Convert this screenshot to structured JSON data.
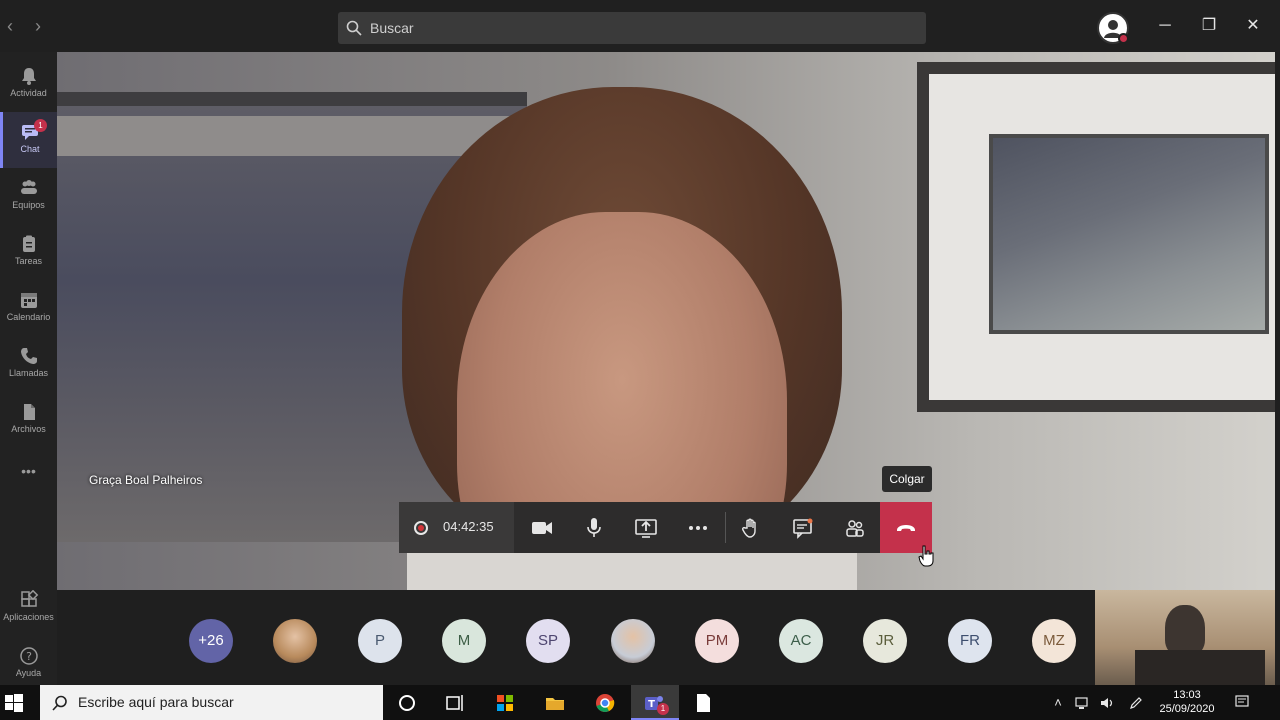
{
  "titlebar": {
    "search_placeholder": "Buscar",
    "back_label": "‹",
    "forward_label": "›",
    "minimize": "─",
    "restore": "❐",
    "close": "✕"
  },
  "rail": {
    "items": [
      {
        "label": "Actividad",
        "icon": "bell-icon"
      },
      {
        "label": "Chat",
        "icon": "chat-icon",
        "badge": "1",
        "active": true
      },
      {
        "label": "Equipos",
        "icon": "teams-icon"
      },
      {
        "label": "Tareas",
        "icon": "tasks-icon"
      },
      {
        "label": "Calendario",
        "icon": "calendar-icon"
      },
      {
        "label": "Llamadas",
        "icon": "phone-icon"
      },
      {
        "label": "Archivos",
        "icon": "files-icon"
      }
    ],
    "more_label": "•••",
    "bottom": [
      {
        "label": "Aplicaciones",
        "icon": "apps-icon"
      },
      {
        "label": "Ayuda",
        "icon": "help-icon"
      }
    ]
  },
  "video": {
    "speaker_name": "Graça Boal Palheiros"
  },
  "controls": {
    "timer": "04:42:35",
    "tooltip": "Colgar",
    "accent": "#c4314b"
  },
  "participants": [
    {
      "initials": "+26",
      "bg": "#6264a7",
      "fg": "#ffffff"
    },
    {
      "initials": "",
      "photo": true,
      "bg": "#b88a5c"
    },
    {
      "initials": "P",
      "bg": "#dde3ec",
      "fg": "#4a5a70"
    },
    {
      "initials": "M",
      "bg": "#d9e6dc",
      "fg": "#3d5e46"
    },
    {
      "initials": "SP",
      "bg": "#e2def0",
      "fg": "#4e4670"
    },
    {
      "initials": "",
      "photo": true,
      "bg": "#c7ccd6"
    },
    {
      "initials": "PM",
      "bg": "#f4dedd",
      "fg": "#7a3c3a"
    },
    {
      "initials": "AC",
      "bg": "#dbe7e0",
      "fg": "#3c5e4a"
    },
    {
      "initials": "JR",
      "bg": "#e7e8dc",
      "fg": "#5b5e3c"
    },
    {
      "initials": "FR",
      "bg": "#dee4ee",
      "fg": "#3d4e6e"
    },
    {
      "initials": "MZ",
      "bg": "#f3e5d8",
      "fg": "#7a5a3a"
    }
  ],
  "taskbar": {
    "search_placeholder": "Escribe aquí para buscar",
    "time": "13:03",
    "date": "25/09/2020",
    "teams_badge": "1"
  }
}
